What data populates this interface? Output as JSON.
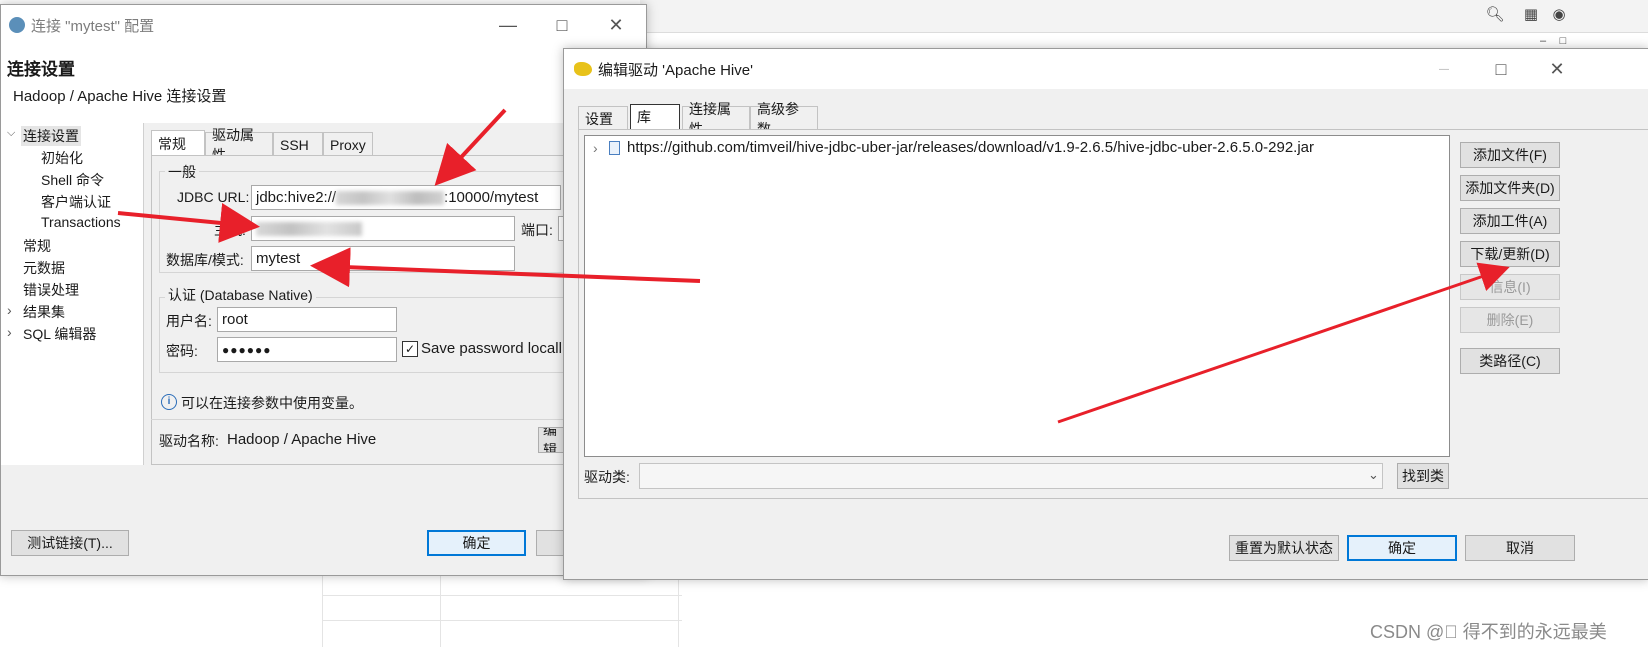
{
  "colors": {
    "accent": "#0078d7",
    "arrow": "#e8202a"
  },
  "conn_window": {
    "title": "连接 \"mytest\" 配置",
    "heading": "连接设置",
    "subheading": "Hadoop / Apache Hive 连接设置",
    "tree": [
      {
        "label": "连接设置",
        "selected": true
      },
      {
        "label": "初始化"
      },
      {
        "label": "Shell 命令"
      },
      {
        "label": "客户端认证"
      },
      {
        "label": "Transactions"
      },
      {
        "label": "常规"
      },
      {
        "label": "元数据"
      },
      {
        "label": "错误处理"
      },
      {
        "label": "结果集"
      },
      {
        "label": "SQL 编辑器"
      }
    ],
    "tabs": [
      "常规",
      "驱动属性",
      "SSH",
      "Proxy"
    ],
    "general_group": "一般",
    "jdbc_label": "JDBC URL:",
    "jdbc_prefix": "jdbc:hive2://",
    "jdbc_suffix": ":10000/mytest",
    "host_label": "主机:",
    "port_label": "端口:",
    "db_label": "数据库/模式:",
    "db_value": "mytest",
    "auth_group": "认证 (Database Native)",
    "user_label": "用户名:",
    "user_value": "root",
    "password_label": "密码:",
    "password_value": "●●●●●●",
    "save_password": "Save password locall",
    "info_text": "可以在连接参数中使用变量。",
    "driver_label": "驱动名称:",
    "driver_value": "Hadoop / Apache Hive",
    "edit_button": "编辑",
    "test_button": "测试链接(T)...",
    "ok_button": "确定"
  },
  "driver_window": {
    "title": "编辑驱动 'Apache Hive'",
    "tabs": [
      "设置",
      "库",
      "连接属性",
      "高级参数"
    ],
    "library_item": "https://github.com/timveil/hive-jdbc-uber-jar/releases/download/v1.9-2.6.5/hive-jdbc-uber-2.6.5.0-292.jar",
    "buttons": {
      "add_file": "添加文件(F)",
      "add_folder": "添加文件夹(D)",
      "add_artifact": "添加工件(A)",
      "download": "下载/更新(D)",
      "info": "信息(I)",
      "delete": "删除(E)",
      "classpath": "类路径(C)",
      "find_class": "找到类",
      "reset": "重置为默认状态",
      "ok": "确定",
      "cancel": "取消"
    },
    "driver_class_label": "驱动类:"
  },
  "watermark": "CSDN @\u0000  得不到的永远最美"
}
